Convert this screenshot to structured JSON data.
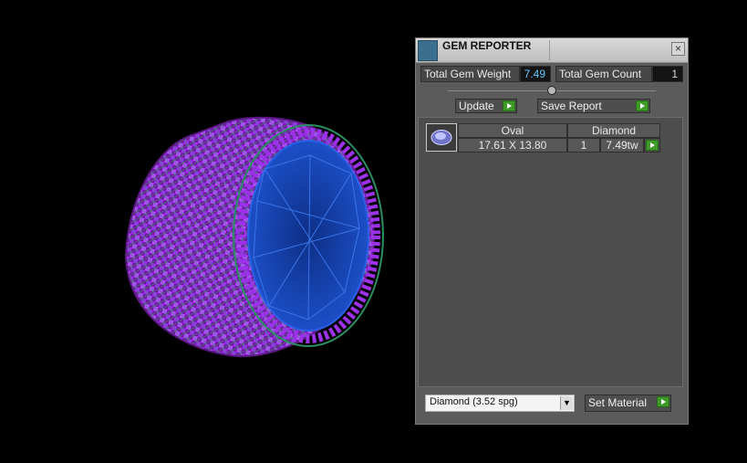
{
  "window": {
    "title": "GEM REPORTER",
    "close_label": "×"
  },
  "stats": {
    "total_weight_label": "Total Gem Weight",
    "total_weight_value": "7.49",
    "total_count_label": "Total Gem Count",
    "total_count_value": "1"
  },
  "slider": {
    "level": 0.5
  },
  "buttons": {
    "update_label": "Update",
    "save_report_label": "Save Report",
    "set_material_label": "Set Material"
  },
  "gem_list": [
    {
      "shape": "Oval",
      "material": "Diamond",
      "size": "17.61 X 13.80",
      "qty": "1",
      "weight": "7.49tw"
    }
  ],
  "material_select": {
    "value": "Diamond    (3.52 spg)",
    "options": [
      "Diamond    (3.52 spg)"
    ]
  },
  "icons": {
    "app": "gem-reporter-icon",
    "close": "close-icon",
    "go": "play-arrow-icon",
    "dropdown": "chevron-down-icon"
  },
  "colors": {
    "accent_green": "#3f9a2a",
    "value_blue": "#61c7ff",
    "metal_purple": "#8a2be2"
  }
}
